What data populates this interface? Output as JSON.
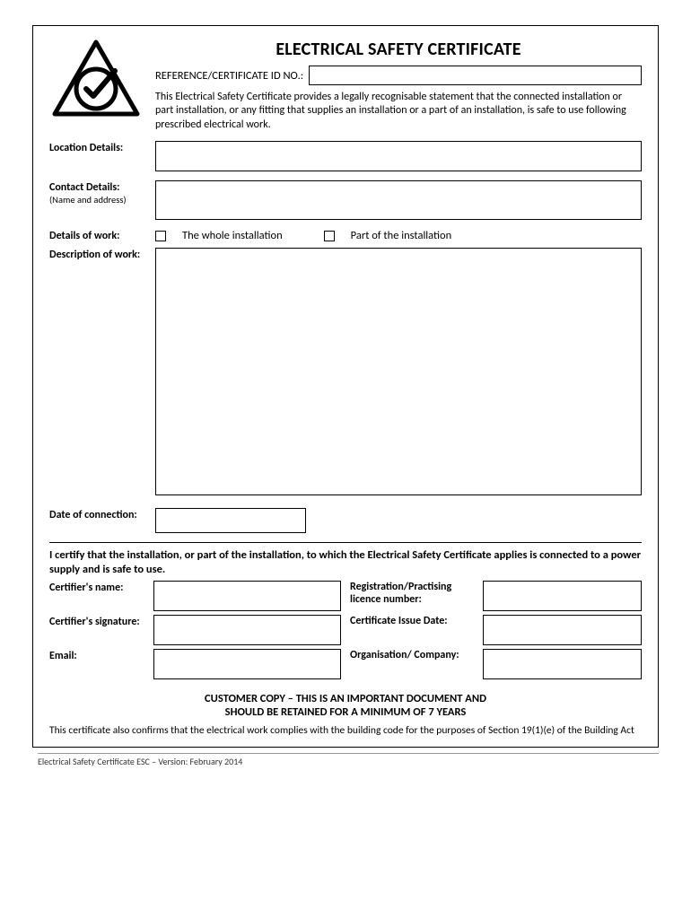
{
  "title": "ELECTRICAL SAFETY CERTIFICATE",
  "ref_label": "REFERENCE/CERTIFICATE ID NO.:",
  "intro": "This Electrical Safety Certificate provides a legally recognisable statement that the connected installation or part installation, or any fitting that supplies an installation or a part of an installation, is safe to use following prescribed electrical work.",
  "labels": {
    "location": "Location Details:",
    "contact": "Contact Details:",
    "contact_sub": "(Name and address)",
    "details_of_work": "Details of work:",
    "whole": "The whole installation",
    "part": "Part of the installation",
    "description": "Description of work:",
    "date_conn": "Date of connection:"
  },
  "certify": "I certify that the installation, or part of the installation, to which the Electrical Safety Certificate applies is connected to a power supply and is safe to use.",
  "cert_fields": {
    "name": "Certifier's name:",
    "reg": "Registration/Practising licence number:",
    "sig": "Certifier's signature:",
    "issue": "Certificate Issue Date:",
    "email": "Email:",
    "org": "Organisation/ Company:"
  },
  "footer1": "CUSTOMER COPY – THIS IS AN IMPORTANT DOCUMENT AND",
  "footer2": "SHOULD BE RETAINED FOR A MINIMUM OF 7 YEARS",
  "footer_note": "This certificate also confirms that the electrical work complies with the building code for the purposes of Section 19(1)(e) of the Building Act",
  "version": "Electrical Safety Certificate ESC – Version: February 2014"
}
